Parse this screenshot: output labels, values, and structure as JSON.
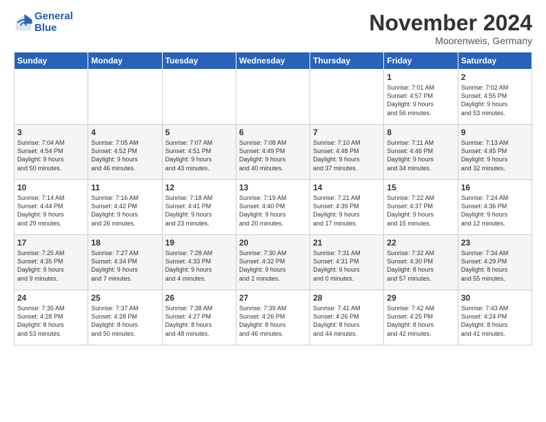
{
  "header": {
    "logo_line1": "General",
    "logo_line2": "Blue",
    "month_title": "November 2024",
    "location": "Moorenweis, Germany"
  },
  "weekdays": [
    "Sunday",
    "Monday",
    "Tuesday",
    "Wednesday",
    "Thursday",
    "Friday",
    "Saturday"
  ],
  "weeks": [
    [
      {
        "day": "",
        "info": ""
      },
      {
        "day": "",
        "info": ""
      },
      {
        "day": "",
        "info": ""
      },
      {
        "day": "",
        "info": ""
      },
      {
        "day": "",
        "info": ""
      },
      {
        "day": "1",
        "info": "Sunrise: 7:01 AM\nSunset: 4:57 PM\nDaylight: 9 hours\nand 56 minutes."
      },
      {
        "day": "2",
        "info": "Sunrise: 7:02 AM\nSunset: 4:55 PM\nDaylight: 9 hours\nand 53 minutes."
      }
    ],
    [
      {
        "day": "3",
        "info": "Sunrise: 7:04 AM\nSunset: 4:54 PM\nDaylight: 9 hours\nand 50 minutes."
      },
      {
        "day": "4",
        "info": "Sunrise: 7:05 AM\nSunset: 4:52 PM\nDaylight: 9 hours\nand 46 minutes."
      },
      {
        "day": "5",
        "info": "Sunrise: 7:07 AM\nSunset: 4:51 PM\nDaylight: 9 hours\nand 43 minutes."
      },
      {
        "day": "6",
        "info": "Sunrise: 7:08 AM\nSunset: 4:49 PM\nDaylight: 9 hours\nand 40 minutes."
      },
      {
        "day": "7",
        "info": "Sunrise: 7:10 AM\nSunset: 4:48 PM\nDaylight: 9 hours\nand 37 minutes."
      },
      {
        "day": "8",
        "info": "Sunrise: 7:11 AM\nSunset: 4:46 PM\nDaylight: 9 hours\nand 34 minutes."
      },
      {
        "day": "9",
        "info": "Sunrise: 7:13 AM\nSunset: 4:45 PM\nDaylight: 9 hours\nand 32 minutes."
      }
    ],
    [
      {
        "day": "10",
        "info": "Sunrise: 7:14 AM\nSunset: 4:44 PM\nDaylight: 9 hours\nand 29 minutes."
      },
      {
        "day": "11",
        "info": "Sunrise: 7:16 AM\nSunset: 4:42 PM\nDaylight: 9 hours\nand 26 minutes."
      },
      {
        "day": "12",
        "info": "Sunrise: 7:18 AM\nSunset: 4:41 PM\nDaylight: 9 hours\nand 23 minutes."
      },
      {
        "day": "13",
        "info": "Sunrise: 7:19 AM\nSunset: 4:40 PM\nDaylight: 9 hours\nand 20 minutes."
      },
      {
        "day": "14",
        "info": "Sunrise: 7:21 AM\nSunset: 4:39 PM\nDaylight: 9 hours\nand 17 minutes."
      },
      {
        "day": "15",
        "info": "Sunrise: 7:22 AM\nSunset: 4:37 PM\nDaylight: 9 hours\nand 15 minutes."
      },
      {
        "day": "16",
        "info": "Sunrise: 7:24 AM\nSunset: 4:36 PM\nDaylight: 9 hours\nand 12 minutes."
      }
    ],
    [
      {
        "day": "17",
        "info": "Sunrise: 7:25 AM\nSunset: 4:35 PM\nDaylight: 9 hours\nand 9 minutes."
      },
      {
        "day": "18",
        "info": "Sunrise: 7:27 AM\nSunset: 4:34 PM\nDaylight: 9 hours\nand 7 minutes."
      },
      {
        "day": "19",
        "info": "Sunrise: 7:28 AM\nSunset: 4:33 PM\nDaylight: 9 hours\nand 4 minutes."
      },
      {
        "day": "20",
        "info": "Sunrise: 7:30 AM\nSunset: 4:32 PM\nDaylight: 9 hours\nand 2 minutes."
      },
      {
        "day": "21",
        "info": "Sunrise: 7:31 AM\nSunset: 4:31 PM\nDaylight: 9 hours\nand 0 minutes."
      },
      {
        "day": "22",
        "info": "Sunrise: 7:32 AM\nSunset: 4:30 PM\nDaylight: 8 hours\nand 57 minutes."
      },
      {
        "day": "23",
        "info": "Sunrise: 7:34 AM\nSunset: 4:29 PM\nDaylight: 8 hours\nand 55 minutes."
      }
    ],
    [
      {
        "day": "24",
        "info": "Sunrise: 7:35 AM\nSunset: 4:28 PM\nDaylight: 8 hours\nand 53 minutes."
      },
      {
        "day": "25",
        "info": "Sunrise: 7:37 AM\nSunset: 4:28 PM\nDaylight: 8 hours\nand 50 minutes."
      },
      {
        "day": "26",
        "info": "Sunrise: 7:38 AM\nSunset: 4:27 PM\nDaylight: 8 hours\nand 48 minutes."
      },
      {
        "day": "27",
        "info": "Sunrise: 7:39 AM\nSunset: 4:26 PM\nDaylight: 8 hours\nand 46 minutes."
      },
      {
        "day": "28",
        "info": "Sunrise: 7:41 AM\nSunset: 4:26 PM\nDaylight: 8 hours\nand 44 minutes."
      },
      {
        "day": "29",
        "info": "Sunrise: 7:42 AM\nSunset: 4:25 PM\nDaylight: 8 hours\nand 42 minutes."
      },
      {
        "day": "30",
        "info": "Sunrise: 7:43 AM\nSunset: 4:24 PM\nDaylight: 8 hours\nand 41 minutes."
      }
    ]
  ]
}
